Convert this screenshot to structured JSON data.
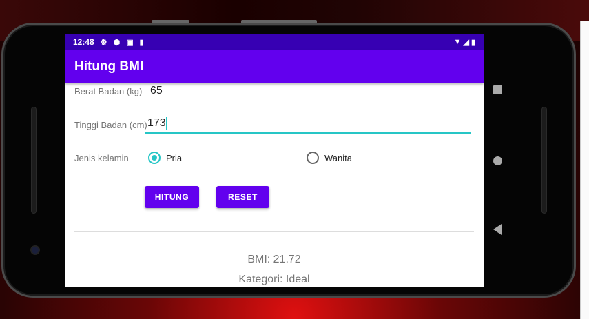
{
  "status": {
    "time": "12:48",
    "icons": [
      "gear-icon",
      "shield-icon",
      "a-icon",
      "sdcard-icon"
    ],
    "right_icons": [
      "wifi-icon",
      "signal-icon",
      "battery-icon"
    ]
  },
  "appbar": {
    "title": "Hitung BMI"
  },
  "form": {
    "weight_label": "Berat Badan (kg)",
    "weight_value": "65",
    "height_label": "Tinggi Badan (cm)",
    "height_value": "173",
    "gender_label": "Jenis kelamin",
    "gender_options": [
      "Pria",
      "Wanita"
    ],
    "gender_selected": "Pria"
  },
  "buttons": {
    "calculate": "HITUNG",
    "reset": "RESET"
  },
  "result": {
    "bmi": "BMI: 21.72",
    "category": "Kategori: Ideal"
  },
  "colors": {
    "primary": "#6200ee",
    "status": "#3700b3",
    "accent": "#26c6c6"
  }
}
